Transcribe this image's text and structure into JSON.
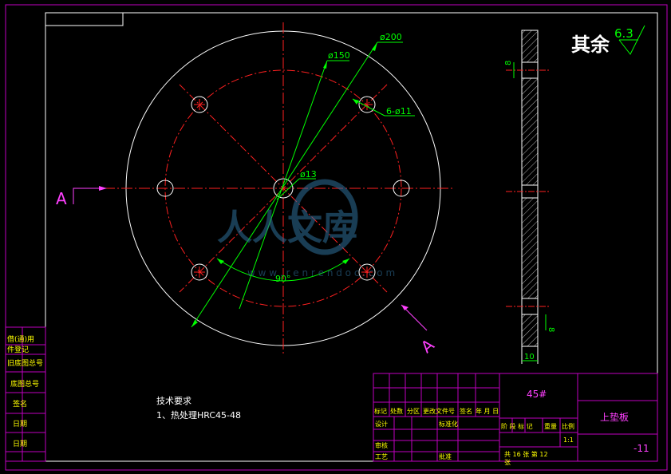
{
  "roughness": {
    "label": "其余",
    "value": "6.3"
  },
  "section": {
    "letter": "A"
  },
  "dimensions": {
    "outer_dia": "ø200",
    "bolt_circle": "ø150",
    "holes": "6-ø11",
    "center_hole": "ø13",
    "angle": "90°",
    "thickness": "10",
    "step_top": "8",
    "step_bottom": "8"
  },
  "tech_req": {
    "title": "技术要求",
    "item1": "1、热处理HRC45-48"
  },
  "title_block": {
    "material": "45#",
    "part_name": "上垫板",
    "drawing_no": "-11",
    "scale": "1:1",
    "sheet_info": "共 16  张   第 12",
    "sheet_word": "张",
    "labels": {
      "mark": "标记",
      "count": "处数",
      "zone": "分区",
      "change_doc": "更改文件号",
      "sign": "签名",
      "ymd": "年 月 日",
      "design": "设计",
      "standardize": "标准化",
      "check": "审核",
      "process": "工艺",
      "approve": "批准",
      "stage": "阶 段 标 记",
      "weight": "重量",
      "ratio": "比例"
    }
  },
  "side_block": {
    "labels": [
      "借(通)用",
      "件登记",
      "旧底图总号",
      "底图总号",
      "签名",
      "日期",
      "日期"
    ]
  },
  "watermark": {
    "text": "人人文库",
    "url": "w w w . r e n r e n d o c . c o m"
  }
}
